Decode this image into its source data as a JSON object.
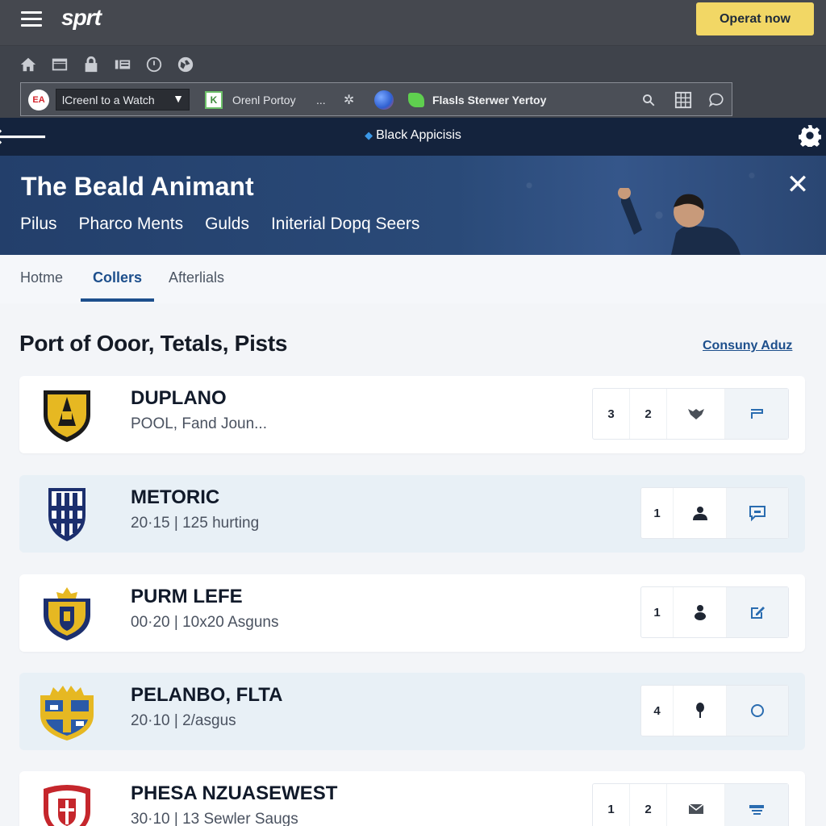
{
  "appbar": {
    "logo": "sprt",
    "cta_label": "Operat now"
  },
  "bookmarks": {
    "ea_logo": "EA",
    "select_value": "lCreenl to a Watch",
    "item1_badge": "K",
    "item1_label": "Orenl Portoy",
    "item2_label": "...",
    "item3_label": "Flasls Sterwer Yertoy"
  },
  "navbar": {
    "title": "Black Appicisis"
  },
  "hero": {
    "title": "The Beald Animant",
    "links": [
      "Pilus",
      "Pharco Ments",
      "Gulds",
      "Initerial Dopq Seers"
    ]
  },
  "tabs": [
    "Hotme",
    "Collers",
    "Afterlials"
  ],
  "section": {
    "title": "Port of Ooor, Tetals, Pists",
    "link": "Consuny Aduz"
  },
  "teams": [
    {
      "name": "DUPLANO",
      "sub": "POOL, Fand Joun...",
      "counts": [
        "3",
        "2"
      ],
      "icons": [
        "wolf-icon",
        "flag-icon"
      ]
    },
    {
      "name": "METORIC",
      "sub": "20·15  |  125 hurting",
      "counts": [
        "1"
      ],
      "icons": [
        "person-icon",
        "chat-icon"
      ]
    },
    {
      "name": "PURM LEFE",
      "sub": "00·20  |  10x20 Asguns",
      "counts": [
        "1"
      ],
      "icons": [
        "person-icon",
        "edit-icon"
      ]
    },
    {
      "name": "PELANBO, FLTA",
      "sub": "20·10  |  2/asgus",
      "counts": [
        "4"
      ],
      "icons": [
        "pin-icon",
        "circle-icon"
      ]
    },
    {
      "name": "PHESA NZUASEWEST",
      "sub": "30·10  |  13 Sewler Saugs",
      "counts": [
        "1",
        "2"
      ],
      "icons": [
        "mail-icon",
        "card-icon"
      ]
    }
  ],
  "colors": {
    "accent": "#1d4f8c",
    "cta": "#f2d765",
    "navbar": "#14233d",
    "appbar": "#45484f"
  }
}
